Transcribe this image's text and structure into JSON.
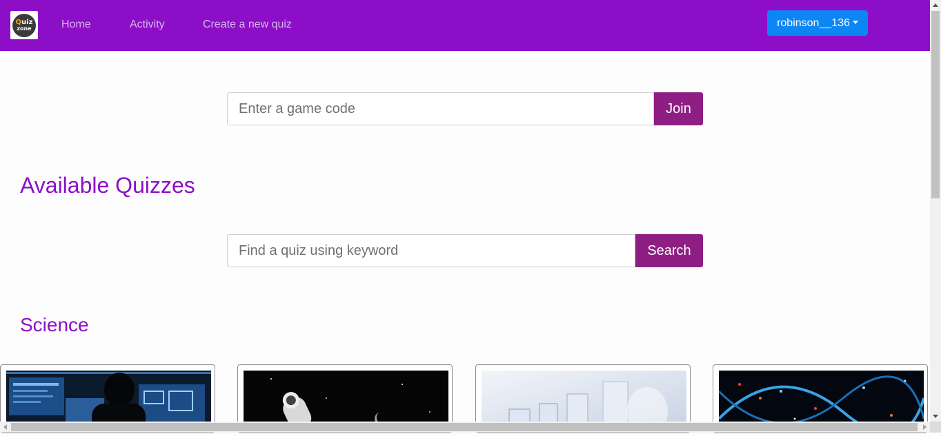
{
  "navbar": {
    "logo": {
      "line1": "uiz",
      "line1_q": "Q",
      "line2": "zone"
    },
    "links": [
      {
        "label": "Home"
      },
      {
        "label": "Activity"
      },
      {
        "label": "Create a new quiz"
      }
    ],
    "user_menu": {
      "label": "robinson__136",
      "icon": "caret-down-icon"
    },
    "colors": {
      "bar": "#8c0fc7",
      "user_button": "#0d86f5"
    }
  },
  "join": {
    "placeholder": "Enter a game code",
    "value": "",
    "button_label": "Join"
  },
  "available_heading": "Available Quizzes",
  "search": {
    "placeholder": "Find a quiz using keyword",
    "value": "",
    "button_label": "Search"
  },
  "category": {
    "title": "Science",
    "cards": [
      {
        "image": "computer-lab-image"
      },
      {
        "image": "astronaut-space-image"
      },
      {
        "image": "lab-glassware-image"
      },
      {
        "image": "dna-helix-image"
      }
    ]
  },
  "colors": {
    "accent": "#8c0fc7",
    "button": "#8e1e83"
  }
}
